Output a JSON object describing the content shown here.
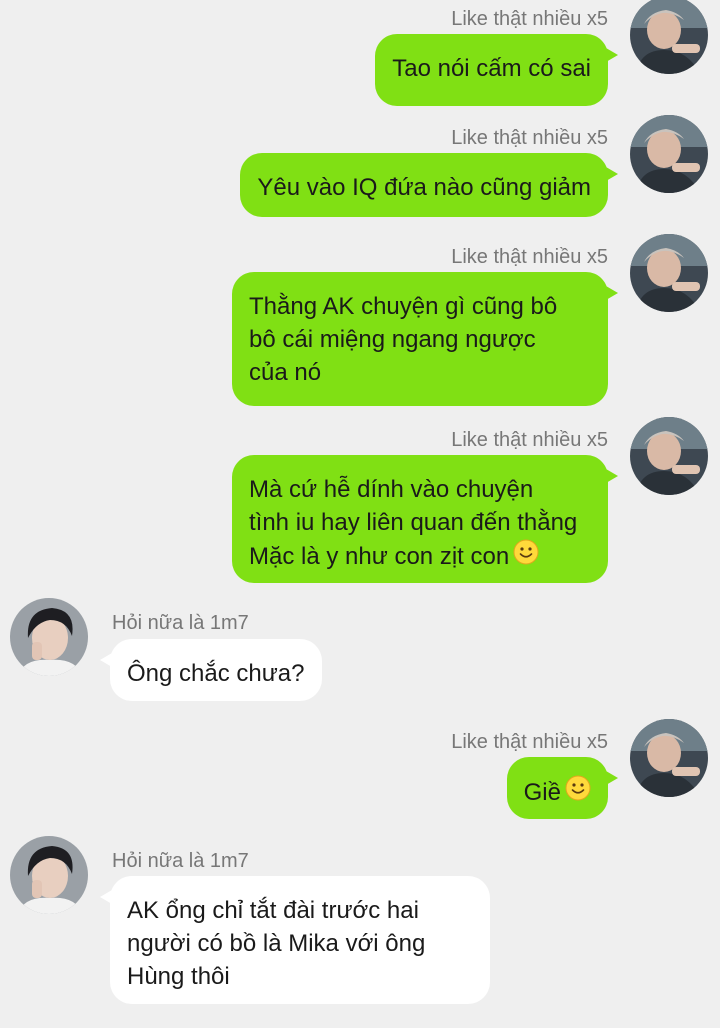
{
  "colors": {
    "background": "#efefef",
    "outgoing_bubble": "#80e014",
    "incoming_bubble": "#ffffff",
    "sender_name": "#777777"
  },
  "messages": [
    {
      "sender": "Like thật nhiều x5",
      "direction": "outgoing",
      "avatar": "avatar-photo-user",
      "lines": [
        "Tao nói cấm có sai"
      ]
    },
    {
      "sender": "Like thật nhiều x5",
      "direction": "outgoing",
      "avatar": "avatar-photo-user",
      "lines": [
        "Yêu vào IQ đứa nào cũng giảm"
      ]
    },
    {
      "sender": "Like thật nhiều x5",
      "direction": "outgoing",
      "avatar": "avatar-photo-user",
      "lines": [
        "Thằng AK chuyện gì cũng bô",
        "bô cái miệng ngang ngược",
        "của nó"
      ]
    },
    {
      "sender": "Like thật nhiều x5",
      "direction": "outgoing",
      "avatar": "avatar-photo-user",
      "lines": [
        "Mà cứ hễ dính vào chuyện",
        "tình iu hay liên quan đến thằng",
        "Mặc là y như con zịt con"
      ],
      "emoji": "smile-emoji-icon"
    },
    {
      "sender": "Hỏi nữa là 1m7",
      "direction": "incoming",
      "avatar": "avatar-photo-friend",
      "lines": [
        "Ông chắc chưa?"
      ]
    },
    {
      "sender": "Like thật nhiều x5",
      "direction": "outgoing",
      "avatar": "avatar-photo-user",
      "lines": [
        "Giề"
      ],
      "emoji": "smile-emoji-icon"
    },
    {
      "sender": "Hỏi nữa là 1m7",
      "direction": "incoming",
      "avatar": "avatar-photo-friend",
      "lines": [
        "AK ổng chỉ tắt đài trước hai",
        "người có bồ là Mika với ông",
        "Hùng thôi"
      ]
    }
  ]
}
